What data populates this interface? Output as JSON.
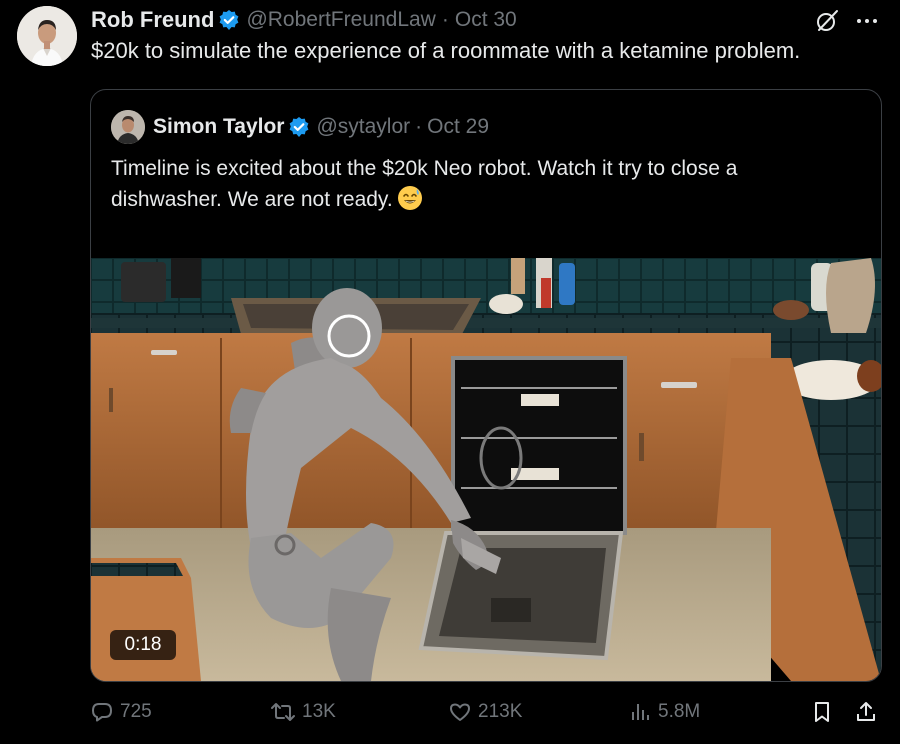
{
  "tweet": {
    "author_name": "Rob Freund",
    "handle": "@RobertFreundLaw",
    "separator": "·",
    "date": "Oct 30",
    "text": "$20k to simulate the experience of a roommate with a ketamine problem."
  },
  "quoted": {
    "author_name": "Simon Taylor",
    "handle": "@sytaylor",
    "separator": "·",
    "date": "Oct 29",
    "text": "Timeline is excited about the $20k Neo robot. Watch it try to close a dishwasher. We are not ready.",
    "emoji": "sweat-smile-emoji",
    "video_duration": "0:18"
  },
  "actions": {
    "replies": "725",
    "reposts": "13K",
    "likes": "213K",
    "views": "5.8M"
  },
  "colors": {
    "background": "#000000",
    "text": "#e7e9ea",
    "muted": "#71767b",
    "verified": "#1d9bf0",
    "border": "#3b3f44"
  },
  "icons": [
    "grok-icon",
    "more-icon",
    "reply-icon",
    "repost-icon",
    "like-icon",
    "views-icon",
    "bookmark-icon",
    "share-icon",
    "verified-badge-icon"
  ]
}
